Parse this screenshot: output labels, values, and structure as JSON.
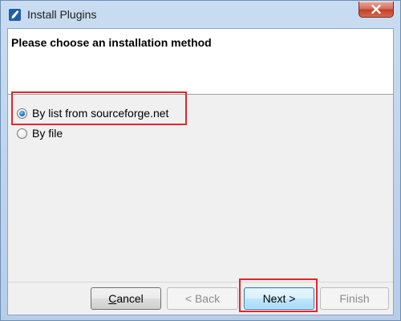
{
  "window": {
    "title": "Install Plugins",
    "close_label": "close"
  },
  "header": {
    "title": "Please choose an installation method"
  },
  "options": [
    {
      "label": "By list from sourceforge.net",
      "selected": true
    },
    {
      "label": "By file",
      "selected": false
    }
  ],
  "buttons": {
    "cancel": {
      "first_letter": "C",
      "rest": "ancel",
      "enabled": true
    },
    "back": {
      "label": "< Back",
      "enabled": false
    },
    "next": {
      "label": "Next >",
      "enabled": true
    },
    "finish": {
      "label": "Finish",
      "enabled": false
    }
  },
  "colors": {
    "highlight": "#e2262e",
    "title_bar": "#c9dcf1",
    "content_bg": "#f0f0f0",
    "radio_selected": "#1b72c9"
  },
  "icons": {
    "app": "feather-app-icon",
    "close": "close-x-icon"
  }
}
